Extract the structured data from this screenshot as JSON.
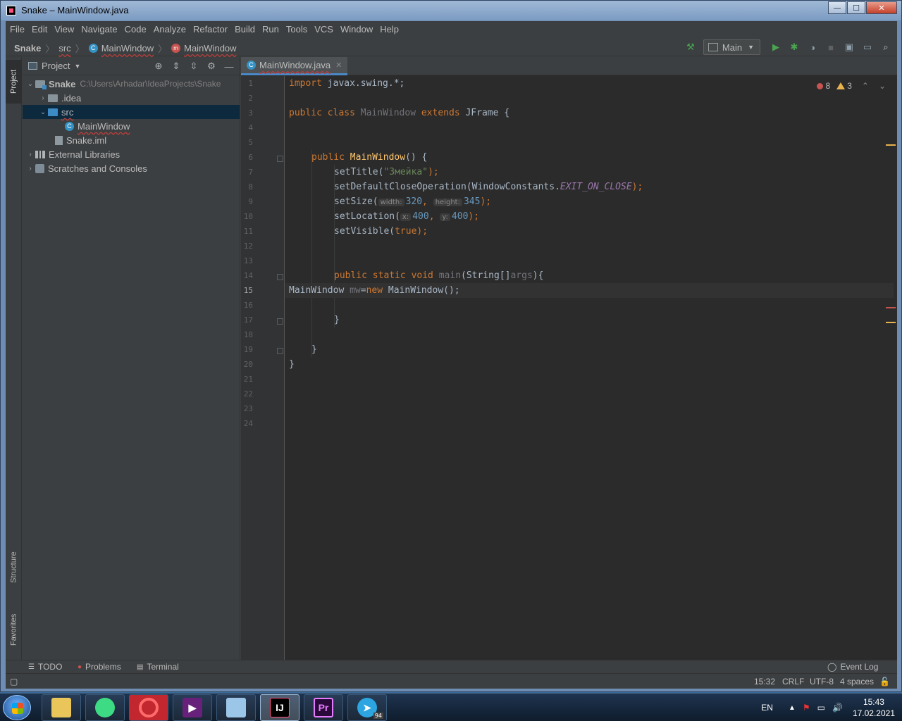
{
  "window": {
    "title": "Snake – MainWindow.java",
    "min": "—",
    "max": "☐",
    "close": "✕"
  },
  "menu": [
    "File",
    "Edit",
    "View",
    "Navigate",
    "Code",
    "Analyze",
    "Refactor",
    "Build",
    "Run",
    "Tools",
    "VCS",
    "Window",
    "Help"
  ],
  "breadcrumb": {
    "project": "Snake",
    "folder": "src",
    "cls": "MainWindow",
    "method": "MainWindow"
  },
  "toolbar": {
    "run_config": "Main"
  },
  "sidebar": {
    "project_tab": "Project",
    "structure_tab": "Structure",
    "favorites_tab": "Favorites"
  },
  "project_panel": {
    "title": "Project",
    "tree": {
      "root": "Snake",
      "root_path": "C:\\Users\\Arhadar\\IdeaProjects\\Snake",
      "idea": ".idea",
      "src": "src",
      "main_window": "MainWindow",
      "iml": "Snake.iml",
      "ext_libs": "External Libraries",
      "scratches": "Scratches and Consoles"
    }
  },
  "editor": {
    "tab": "MainWindow.java",
    "errors": "8",
    "warnings": "3",
    "line_numbers": [
      "1",
      "2",
      "3",
      "4",
      "5",
      "6",
      "7",
      "8",
      "9",
      "10",
      "11",
      "12",
      "13",
      "14",
      "15",
      "16",
      "17",
      "18",
      "19",
      "20",
      "21",
      "22",
      "23",
      "24"
    ],
    "current_line": "15",
    "code": {
      "l1_kw": "import",
      "l1_rest": " javax.swing.*;",
      "l3_kw": "public class ",
      "l3_name": "MainWindow",
      "l3_ext": " extends ",
      "l3_rest": "JFrame {",
      "l6_kw": "public ",
      "l6_name": "MainWindow",
      "l6_rest": "() {",
      "l7_a": "setTitle(",
      "l7_str": "\"Змейка\"",
      "l7_b": ");",
      "l8_a": "setDefaultCloseOperation(WindowConstants.",
      "l8_const": "EXIT_ON_CLOSE",
      "l8_b": ");",
      "l9_a": "setSize(",
      "l9_h1": "width:",
      "l9_n1": "320",
      "l9_sep": ", ",
      "l9_h2": "height:",
      "l9_n2": "345",
      "l9_b": ");",
      "l10_a": "setLocation(",
      "l10_h1": "x:",
      "l10_n1": "400",
      "l10_sep": ", ",
      "l10_h2": "y:",
      "l10_n2": "400",
      "l10_b": ");",
      "l11_a": "setVisible(",
      "l11_kw": "true",
      "l11_b": ");",
      "l14_kw": "public static void ",
      "l14_name": "main",
      "l14_a": "(String[]",
      "l14_arg": "args",
      "l14_b": "){",
      "l15_a": "MainWindow ",
      "l15_var": "mw",
      "l15_eq": "=",
      "l15_kw": "new",
      "l15_b": " MainWindow();",
      "l17": "}",
      "l19": "}",
      "l20": "}"
    }
  },
  "bottom_tools": {
    "todo": "TODO",
    "problems": "Problems",
    "terminal": "Terminal",
    "event_log": "Event Log"
  },
  "status": {
    "position": "15:32",
    "line_sep": "CRLF",
    "encoding": "UTF-8",
    "indent": "4 spaces"
  },
  "taskbar": {
    "ij_label": "IJ",
    "pr_label": "Pr",
    "tg_badge": "94",
    "lang": "EN",
    "time": "15:43",
    "date": "17.02.2021"
  },
  "colors": {
    "accent": "#4a88c7",
    "error": "#c75450",
    "warning": "#e8b24e",
    "keyword": "#cc7832",
    "method": "#ffc66d",
    "string": "#6a8759"
  }
}
